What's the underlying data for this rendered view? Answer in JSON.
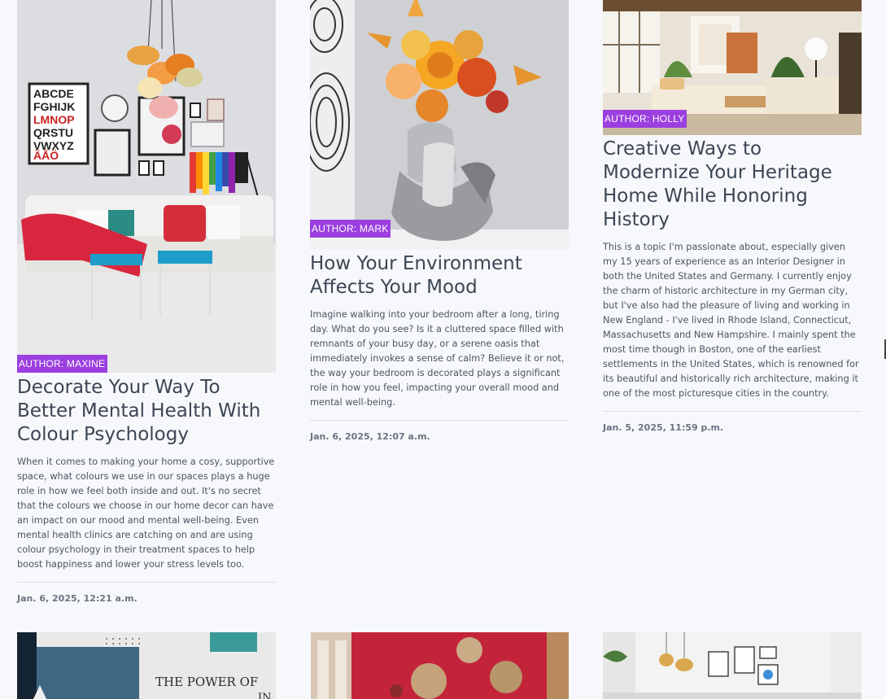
{
  "posts": [
    {
      "author": "AUTHOR: MAXINE",
      "title": "Decorate Your Way To Better Mental Health With Colour Psychology",
      "excerpt": "When it comes to making your home a cosy, supportive space, what colours we use in our spaces plays a huge role in how we feel both inside and out. It's no secret that the colours we choose in our home decor can have an impact on our mood and mental well-being. Even mental health clinics are catching on and are using colour psychology in their treatment spaces to help boost happiness and lower your stress levels too.",
      "date": "Jan. 6, 2025, 12:21 a.m."
    },
    {
      "author": "AUTHOR: MARK",
      "title": "How Your Environment Affects Your Mood",
      "excerpt": "Imagine walking into your bedroom after a long, tiring day. What do you see? Is it a cluttered space filled with remnants of your busy day, or a serene oasis that immediately invokes a sense of calm? Believe it or not, the way your bedroom is decorated plays a significant role in how you feel, impacting your overall mood and mental well-being.",
      "date": "Jan. 6, 2025, 12:07 a.m."
    },
    {
      "author": "AUTHOR: HOLLY",
      "title": "Creative Ways to Modernize Your Heritage Home While Honoring History",
      "excerpt": "This is a topic I'm passionate about, especially given my 15 years of experience as an Interior Designer in both the United States and Germany. I currently enjoy the charm of historic architecture in my German city, but I've also had the pleasure of living and working in New England - I've lived in Rhode Island, Connecticut, Massachusetts and New Hampshire. I mainly spent the most time though in Boston, one of the earliest settlements in the United States, which is renowned for its beautiful and historically rich architecture, making it one of the most picturesque cities in the country.",
      "date": "Jan. 5, 2025, 11:59 p.m."
    }
  ],
  "next_row": {
    "poster_text_line1": "THE POWER OF",
    "poster_text_line2": "IN"
  }
}
